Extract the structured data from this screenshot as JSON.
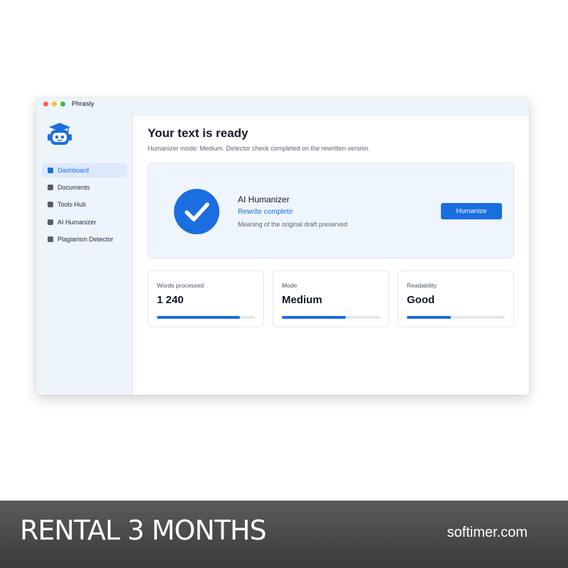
{
  "window": {
    "title": "Phrasly"
  },
  "sidebar": {
    "items": [
      {
        "label": "Dashboard",
        "active": true
      },
      {
        "label": "Documents",
        "active": false
      },
      {
        "label": "Tools Hub",
        "active": false
      },
      {
        "label": "AI Humanizer",
        "active": false
      },
      {
        "label": "Plagiarism Detector",
        "active": false
      }
    ]
  },
  "main": {
    "title": "Your text is ready",
    "subtitle": "Humanizer mode: Medium. Detector check completed on the rewritten version.",
    "hero": {
      "tool_name": "AI Humanizer",
      "status": "Rewrite complete",
      "note": "Meaning of the original draft preserved",
      "button_label": "Humanize"
    },
    "stats": [
      {
        "label": "Words processed",
        "value": "1 240",
        "progress": 0.85
      },
      {
        "label": "Mode",
        "value": "Medium",
        "progress": 0.65
      },
      {
        "label": "Readability",
        "value": "Good",
        "progress": 0.45
      }
    ]
  },
  "banner": {
    "text": "RENTAL 3 MONTHS",
    "site": "softimer.com"
  },
  "colors": {
    "accent": "#1a6ee0",
    "sidebar_bg": "#eef4fc",
    "hero_bg": "#eff5fc"
  }
}
